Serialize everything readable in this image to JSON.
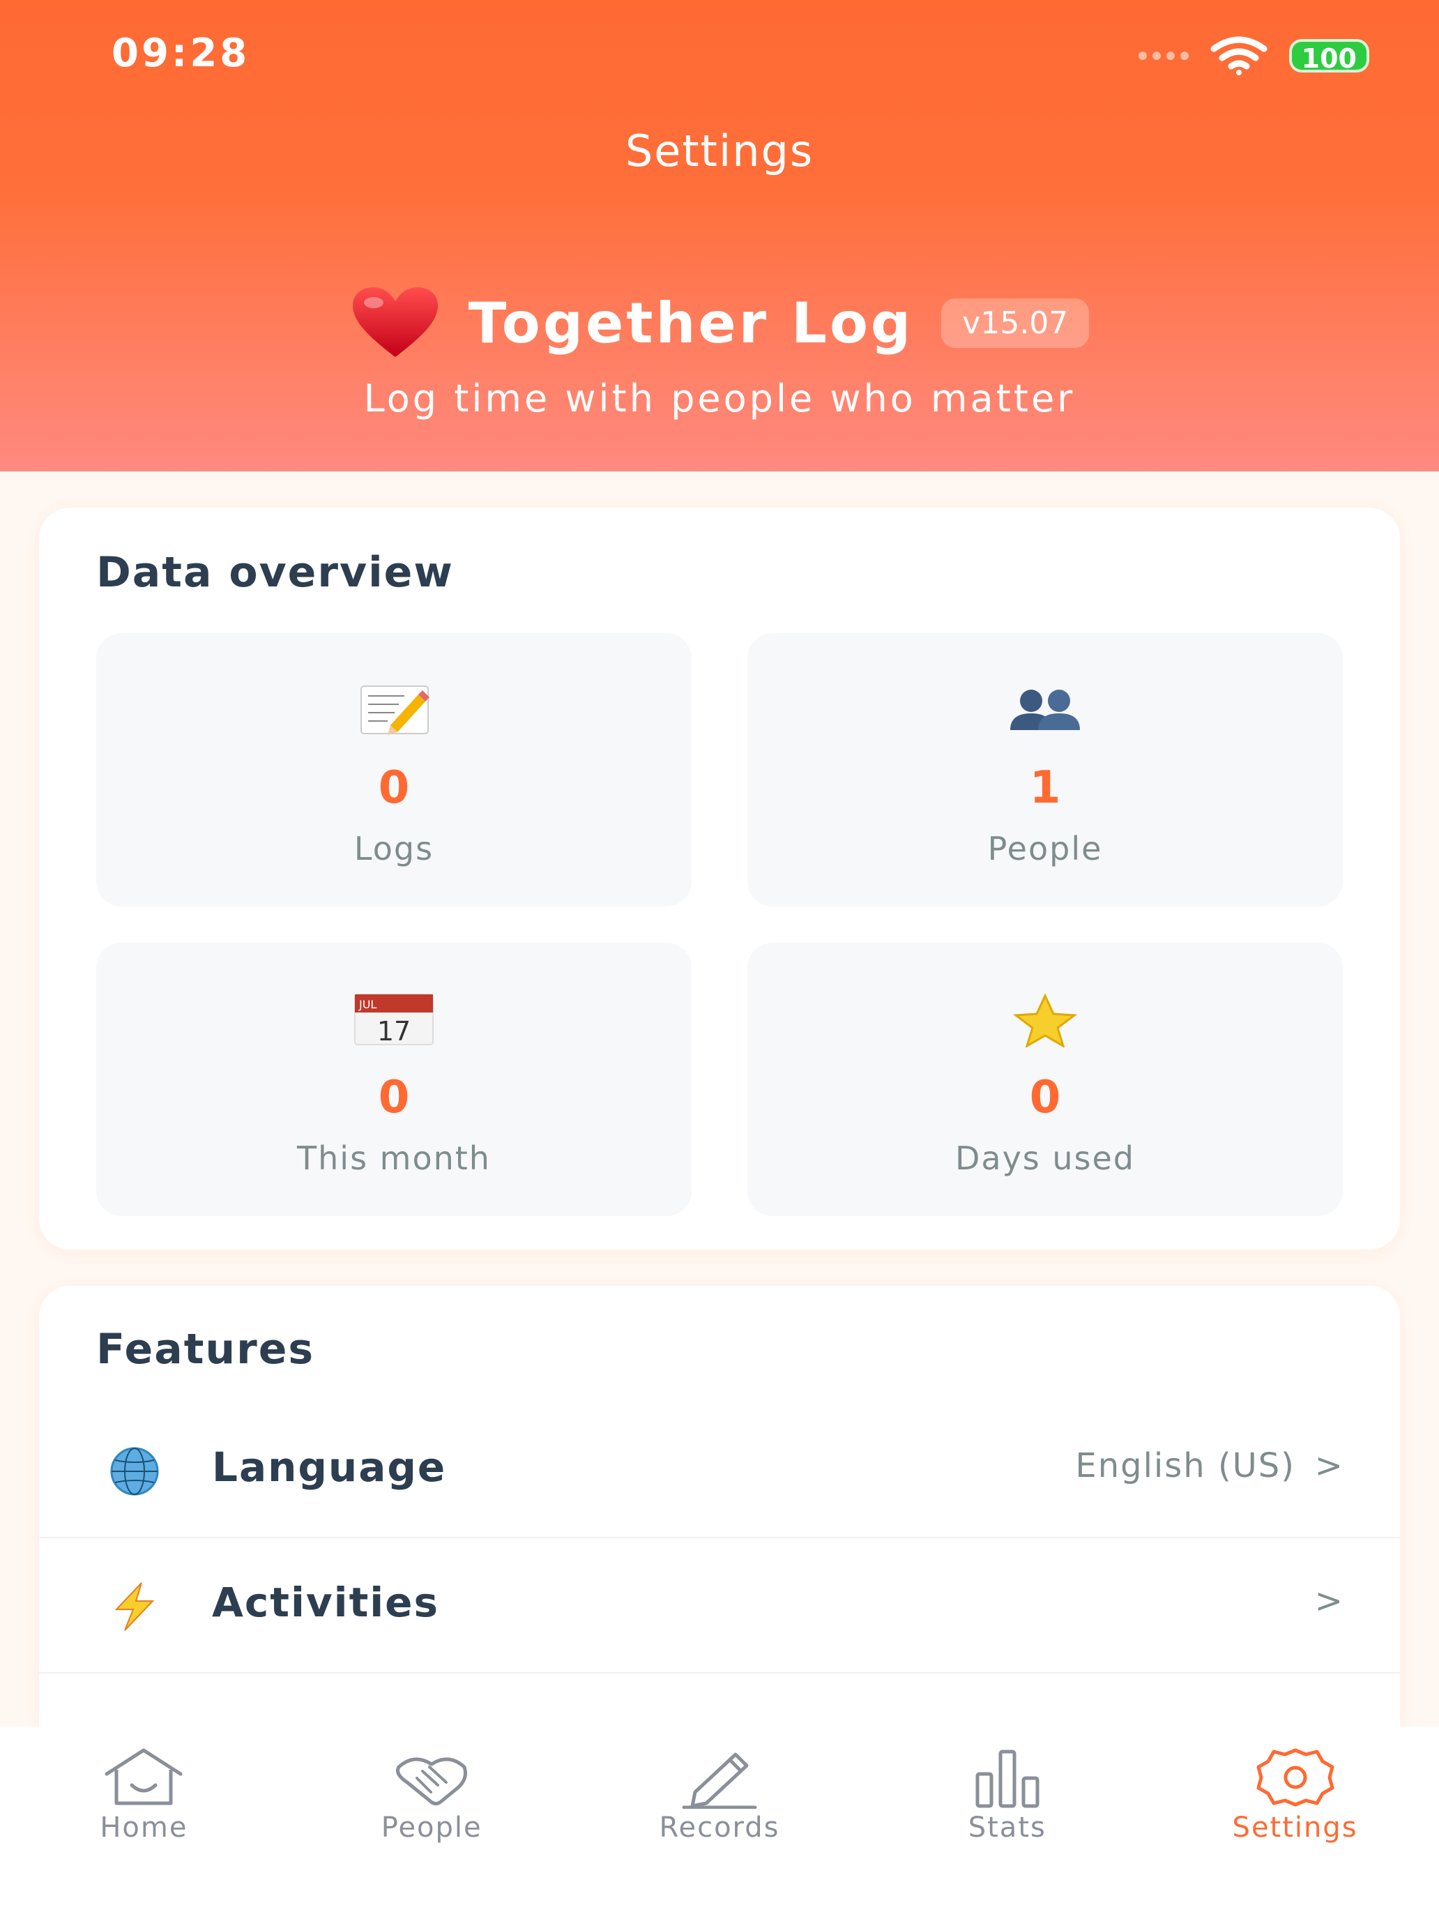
{
  "status_bar": {
    "time": "09:28",
    "battery": "100"
  },
  "header": {
    "title": "Settings",
    "app_name": "Together Log",
    "version": "v15.07",
    "tagline": "Log time with people who matter"
  },
  "overview": {
    "title": "Data overview",
    "stats": [
      {
        "icon": "memo-icon",
        "value": "0",
        "label": "Logs"
      },
      {
        "icon": "people-icon",
        "value": "1",
        "label": "People"
      },
      {
        "icon": "calendar-icon",
        "value": "0",
        "label": "This month",
        "calendar_month": "JUL",
        "calendar_day": "17"
      },
      {
        "icon": "star-icon",
        "value": "0",
        "label": "Days used"
      }
    ]
  },
  "features": {
    "title": "Features",
    "items": [
      {
        "icon": "globe-icon",
        "label": "Language",
        "value": "English (US)",
        "chevron": ">"
      },
      {
        "icon": "lightning-icon",
        "label": "Activities",
        "value": "",
        "chevron": ">"
      }
    ]
  },
  "tabbar": {
    "tabs": [
      {
        "icon": "home-icon",
        "label": "Home",
        "active": false
      },
      {
        "icon": "handshake-icon",
        "label": "People",
        "active": false
      },
      {
        "icon": "pencil-icon",
        "label": "Records",
        "active": false
      },
      {
        "icon": "bar-chart-icon",
        "label": "Stats",
        "active": false
      },
      {
        "icon": "gear-icon",
        "label": "Settings",
        "active": true
      }
    ]
  },
  "colors": {
    "accent": "#ff6a33",
    "header_gradient_top": "#ff6a33",
    "header_gradient_bottom": "#ff8a80",
    "page_bg": "#fff7f1",
    "battery": "#2ecc40"
  }
}
